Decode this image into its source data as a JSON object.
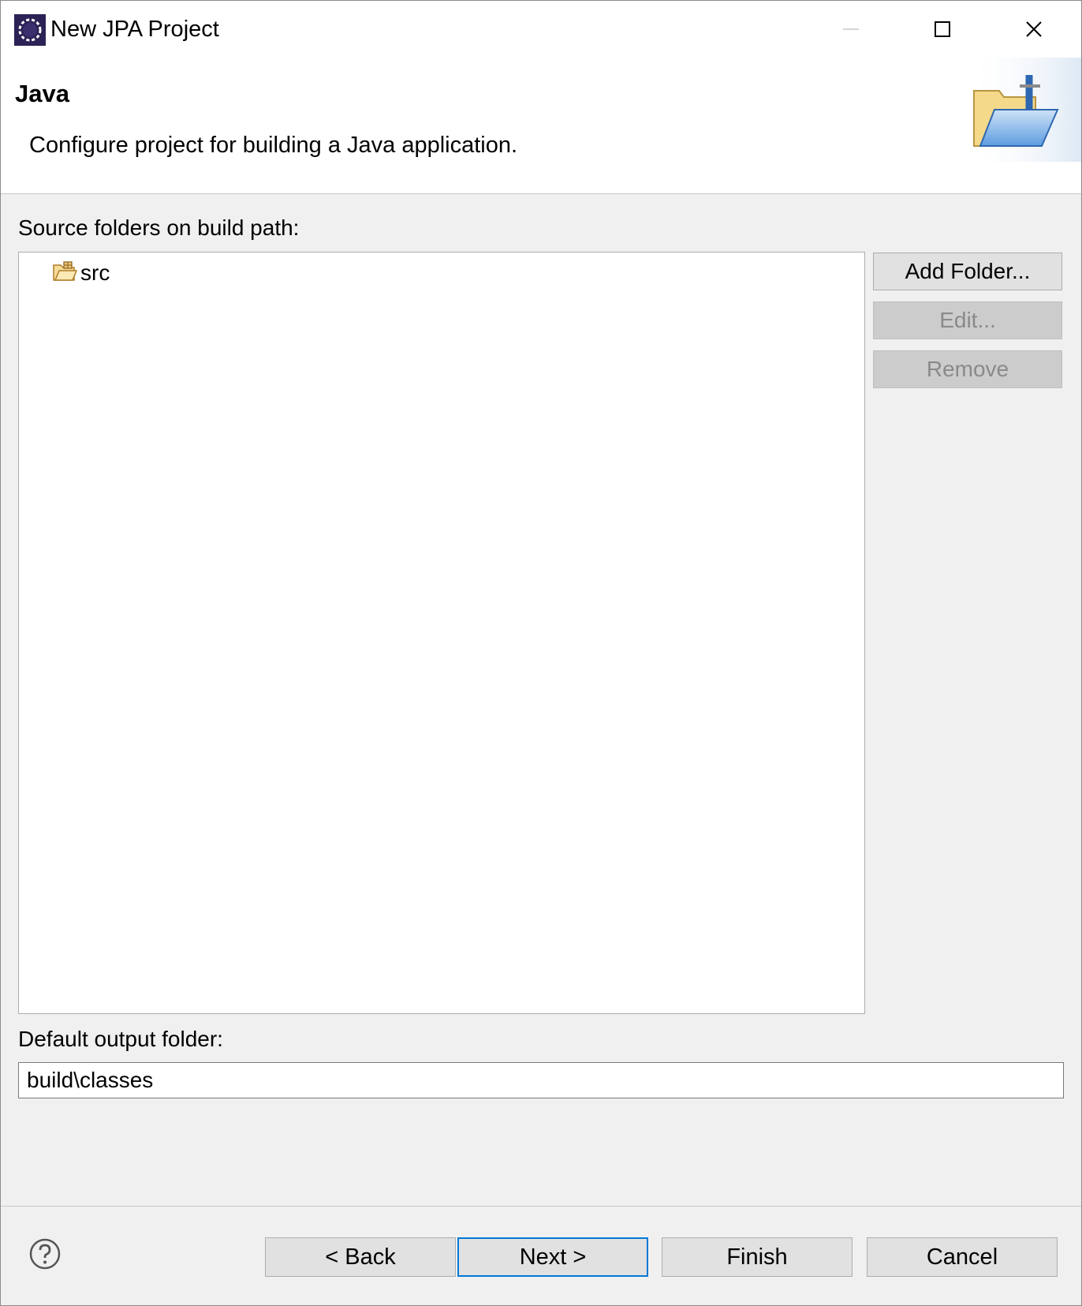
{
  "window": {
    "title": "New JPA Project",
    "app_icon": "eclipse-icon",
    "controls": [
      "minimize-icon",
      "maximize-icon",
      "close-icon"
    ]
  },
  "banner": {
    "title": "Java",
    "description": "Configure project for building a Java application.",
    "icon": "java-folder-wizard-icon"
  },
  "source_folders": {
    "label": "Source folders on build path:",
    "items": [
      {
        "name": "src",
        "icon": "package-folder-icon"
      }
    ],
    "buttons": {
      "add": "Add Folder...",
      "edit": "Edit...",
      "remove": "Remove"
    }
  },
  "output": {
    "label": "Default output folder:",
    "value": "build\\classes"
  },
  "footer": {
    "help_icon": "help-icon",
    "back": "< Back",
    "next": "Next >",
    "finish": "Finish",
    "cancel": "Cancel"
  },
  "colors": {
    "dialog_bg": "#f0f0f0",
    "accent": "#0078d7",
    "disabled_text": "#8a8a8a"
  }
}
